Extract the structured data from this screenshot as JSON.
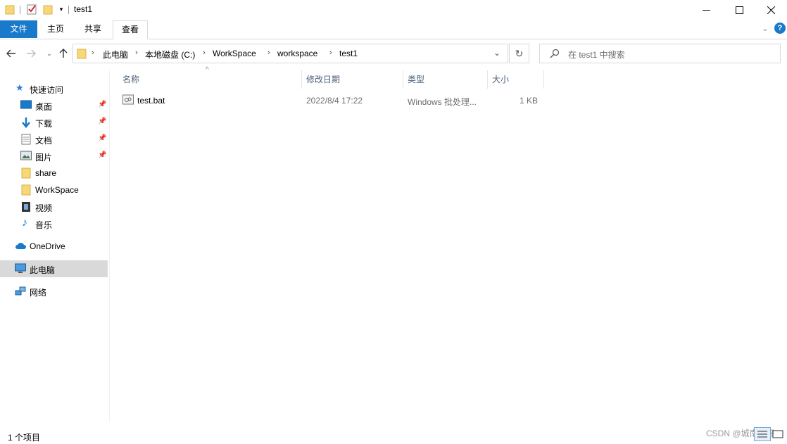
{
  "window": {
    "title": "test1"
  },
  "ribbon": {
    "tabs": [
      "文件",
      "主页",
      "共享",
      "查看"
    ]
  },
  "address": {
    "crumbs": [
      "此电脑",
      "本地磁盘 (C:)",
      "WorkSpace",
      "workspace",
      "test1"
    ]
  },
  "search": {
    "placeholder": "在 test1 中搜索"
  },
  "nav": {
    "quick_access": "快速访问",
    "items": [
      "桌面",
      "下载",
      "文档",
      "图片",
      "share",
      "WorkSpace",
      "视频",
      "音乐"
    ],
    "onedrive": "OneDrive",
    "this_pc": "此电脑",
    "network": "网络"
  },
  "columns": {
    "name": "名称",
    "modified": "修改日期",
    "type": "类型",
    "size": "大小"
  },
  "files": [
    {
      "name": "test.bat",
      "modified": "2022/8/4 17:22",
      "type": "Windows 批处理...",
      "size": "1 KB"
    }
  ],
  "status": {
    "count": "1 个项目"
  },
  "watermark": "CSDN @城南花开",
  "colors": {
    "accent": "#1979ca",
    "selected": "#d9d9d9",
    "folder": "#f8d775"
  }
}
